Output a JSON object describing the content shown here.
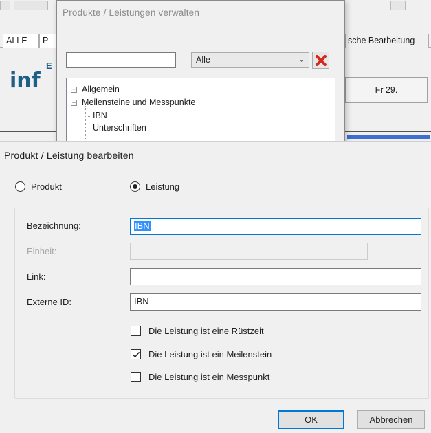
{
  "background": {
    "tabs": {
      "all_label": "ALLE",
      "second_label": "P",
      "right_label": "sche Bearbeitung"
    },
    "logo_text": "inf",
    "logo_small": "E",
    "date_cell": "Fr 29."
  },
  "manage_window": {
    "title": "Produkte / Leistungen verwalten",
    "search_value": "",
    "filter_selected": "Alle",
    "tree": [
      {
        "label": "Allgemein",
        "level": 0,
        "expander": "+"
      },
      {
        "label": "Meilensteine und Messpunkte",
        "level": 0,
        "expander": "−"
      },
      {
        "label": "IBN",
        "level": 1
      },
      {
        "label": "Unterschriften",
        "level": 1
      }
    ]
  },
  "edit_dialog": {
    "title": "Produkt / Leistung bearbeiten",
    "radio_produkt": "Produkt",
    "radio_leistung": "Leistung",
    "selected_type": "Leistung",
    "fields": {
      "bezeichnung_label": "Bezeichnung:",
      "bezeichnung_value": "IBN",
      "einheit_label": "Einheit:",
      "einheit_value": "",
      "link_label": "Link:",
      "link_value": "",
      "externe_id_label": "Externe ID:",
      "externe_id_value": "IBN"
    },
    "checkboxes": [
      {
        "label": "Die Leistung ist eine Rüstzeit",
        "checked": false
      },
      {
        "label": "Die Leistung ist ein Meilenstein",
        "checked": true
      },
      {
        "label": "Die Leistung ist ein Messpunkt",
        "checked": false
      }
    ],
    "ok_label": "OK",
    "cancel_label": "Abbrechen"
  },
  "colors": {
    "accent": "#0078d7",
    "selection": "#3390ff",
    "delete_red": "#d42a1e",
    "logo_blue": "#1d5f86"
  },
  "icons": {
    "delete": "red-x-icon",
    "dropdown": "chevron-down-icon",
    "checkmark": "checkmark-icon"
  }
}
